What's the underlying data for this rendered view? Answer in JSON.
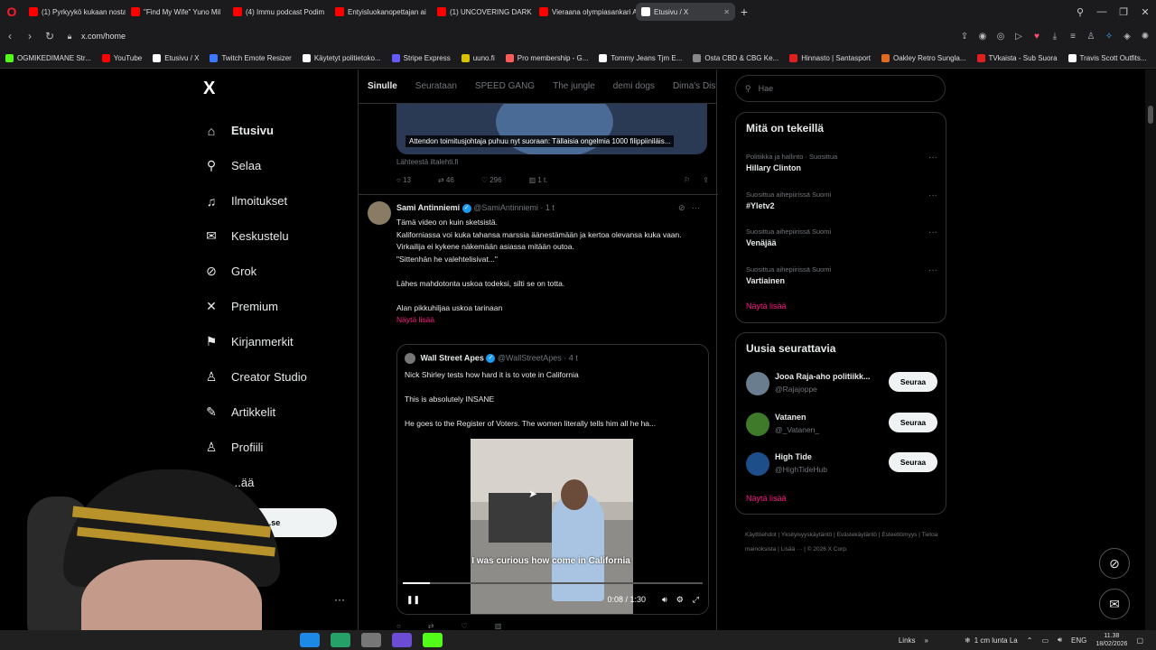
{
  "browser": {
    "tabs": [
      {
        "label": "(1) Pyrkyykö kukaan nosta",
        "color": "#ff0000"
      },
      {
        "label": "\"Find My Wife\" Yuno Mil",
        "color": "#ff0000"
      },
      {
        "label": "(4) Immu podcast Podim",
        "color": "#ff0000"
      },
      {
        "label": "Entyisluokanopettajan ai",
        "color": "#ff0000"
      },
      {
        "label": "(1) UNCOVERING DARK E",
        "color": "#ff0000"
      },
      {
        "label": "Vieraana olympiasankari A",
        "color": "#ff0000"
      },
      {
        "label": "Etusivu / X",
        "color": "#ffffff",
        "active": true
      }
    ],
    "new_tab": "+",
    "url": "x.com/home",
    "bookmarks": [
      {
        "label": "OGMIKEDIMANE Str...",
        "color": "#53fc18"
      },
      {
        "label": "YouTube",
        "color": "#ff0000"
      },
      {
        "label": "Etusivu / X",
        "color": "#ffffff"
      },
      {
        "label": "Twitch Emote Resizer",
        "color": "#3c78ff"
      },
      {
        "label": "Käytetyt politietoko...",
        "color": "#ffffff"
      },
      {
        "label": "Stripe Express",
        "color": "#635bff"
      },
      {
        "label": "uuno.fi",
        "color": "#d8c200"
      },
      {
        "label": "Pro membership - G...",
        "color": "#ff5a5a"
      },
      {
        "label": "Tommy Jeans Tjm E...",
        "color": "#ffffff"
      },
      {
        "label": "Osta CBD & CBG Ke...",
        "color": "#888888"
      },
      {
        "label": "Hinnasto | Santasport",
        "color": "#e02020"
      },
      {
        "label": "Oakley Retro Sungla...",
        "color": "#e06a20"
      },
      {
        "label": "TVkaista - Sub Suora",
        "color": "#e02020"
      },
      {
        "label": "Travis Scott Outfits...",
        "color": "#ffffff"
      }
    ]
  },
  "sidebar": {
    "logo": "X",
    "items": [
      {
        "label": "Etusivu",
        "icon": "home-icon",
        "glyph": "⌂"
      },
      {
        "label": "Selaa",
        "icon": "search-icon",
        "glyph": "⚲"
      },
      {
        "label": "Ilmoitukset",
        "icon": "bell-icon",
        "glyph": "♫"
      },
      {
        "label": "Keskustelu",
        "icon": "envelope-icon",
        "glyph": "✉"
      },
      {
        "label": "Grok",
        "icon": "grok-icon",
        "glyph": "⊘"
      },
      {
        "label": "Premium",
        "icon": "x-premium-icon",
        "glyph": "✕"
      },
      {
        "label": "Kirjanmerkit",
        "icon": "bookmark-icon",
        "glyph": "⚑"
      },
      {
        "label": "Creator Studio",
        "icon": "creator-studio-icon",
        "glyph": "♙"
      },
      {
        "label": "Artikkelit",
        "icon": "article-icon",
        "glyph": "✎"
      },
      {
        "label": "Profiili",
        "icon": "profile-icon",
        "glyph": "♙"
      },
      {
        "label": "...ää",
        "icon": "more-icon",
        "glyph": "…"
      }
    ],
    "post_button": "...se",
    "account_more": "···"
  },
  "feed": {
    "tabs": [
      "Sinulle",
      "Seurataan",
      "SPEED GANG",
      "The jungle",
      "demi dogs",
      "Dima's Dist"
    ],
    "tweet1": {
      "caption": "Attendon toimitusjohtaja puhuu nyt suoraan: Tällaisia ongelmia 1000 filippiiniläis...",
      "source": "Lähteestä iltalehti.fi",
      "replies": "13",
      "retweets": "46",
      "likes": "296",
      "views": "1 t."
    },
    "tweet2": {
      "name": "Sami Antinniemi",
      "handle": "@SamiAntinniemi · 1 t",
      "lines": [
        "Tämä video on kuin sketsistä.",
        "Kaliforniassa voi kuka tahansa marssia äänestämään ja kertoa olevansa kuka vaan.",
        "Virkailija ei kykene näkemään asiassa mitään outoa.",
        "\"Sittenhän he valehtelisivat...\"",
        "",
        "Lähes mahdotonta uskoa todeksi, silti se on totta.",
        "",
        "Alan pikkuhiljaa uskoa tarinaan"
      ],
      "show_more": "Näytä lisää"
    },
    "quote": {
      "name": "Wall Street Apes",
      "handle": "@WallStreetApes · 4 t",
      "lines": [
        "Nick Shirley tests how hard it is to vote in California",
        "",
        "This is absolutely INSANE",
        "",
        "He goes to the Register of Voters. The women literally tells him all he ha..."
      ],
      "video_caption": "I was curious how come in California",
      "time": "0:08 / 1:30",
      "progress": 0.09
    }
  },
  "right": {
    "search_placeholder": "Hae",
    "trends_title": "Mitä on tekeillä",
    "trends": [
      {
        "category": "Politiikka ja hallinto · Suosittua",
        "name": "Hillary Clinton"
      },
      {
        "category": "Suosittua aihepiirissä Suomi",
        "name": "#Yletv2"
      },
      {
        "category": "Suosittua aihepiirissä Suomi",
        "name": "Venäjää"
      },
      {
        "category": "Suosittua aihepiirissä Suomi",
        "name": "Vartiainen"
      }
    ],
    "show_more": "Näytä lisää",
    "follow_title": "Uusia seurattavia",
    "follows": [
      {
        "name": "Jooa Raja-aho politiikk...",
        "handle": "@Rajajoppe",
        "button": "Seuraa",
        "color": "#6a7d8e"
      },
      {
        "name": "Vatanen",
        "handle": "@_Vatanen_",
        "button": "Seuraa",
        "color": "#3e7a2a"
      },
      {
        "name": "High Tide",
        "handle": "@HighTideHub",
        "button": "Seuraa",
        "color": "#1e4e8a"
      }
    ],
    "footer": [
      "Käyttöehdot",
      "Yksityisyyskäytäntö",
      "Evästekäytäntö",
      "Esteettömyys",
      "Tietoa mainoksista",
      "Lisää ···",
      "© 2026 X Corp."
    ]
  },
  "taskbar": {
    "links": "Links",
    "weather": "1 cm lunta La",
    "lang": "ENG",
    "time": "11.38",
    "date": "18/02/2026"
  }
}
